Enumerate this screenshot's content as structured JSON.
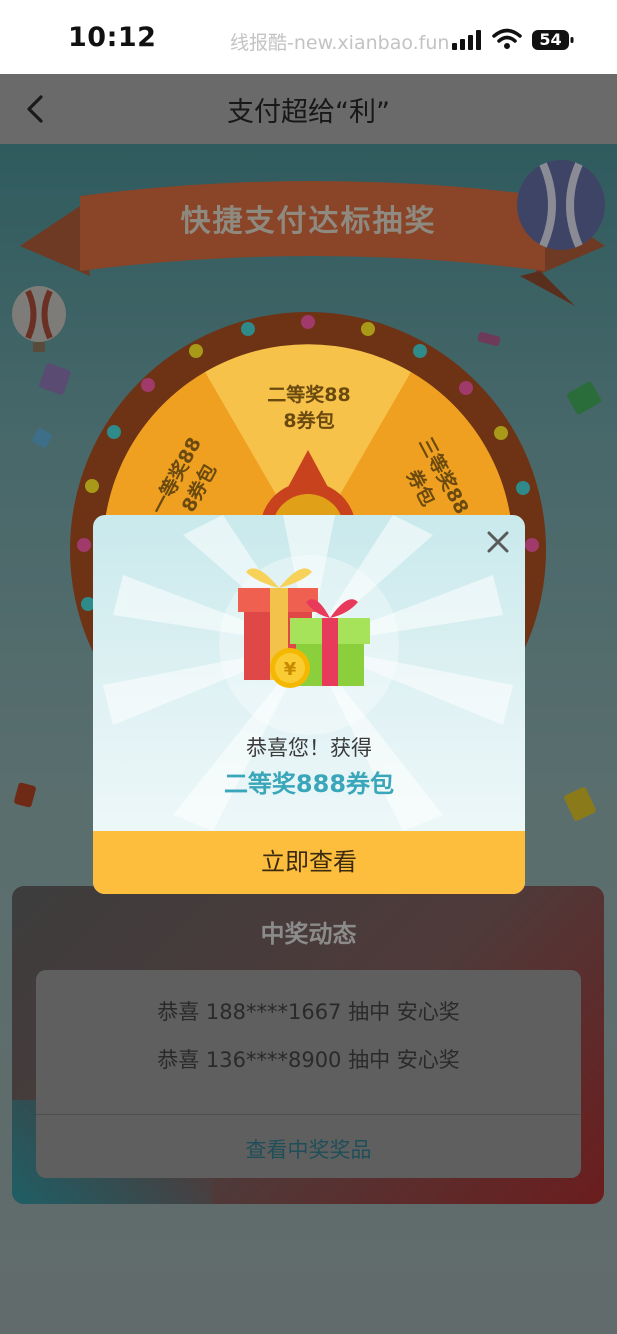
{
  "status_bar": {
    "time": "10:12",
    "watermark": "线报酷-new.xianbao.fun",
    "battery": "54"
  },
  "nav": {
    "title": "支付超给“利”"
  },
  "banner": {
    "title": "快捷支付达标抽奖"
  },
  "wheel": {
    "segments": [
      {
        "label": "二等奖88\n8券包"
      },
      {
        "label": "一等奖88\n8券包"
      },
      {
        "label": "三等奖88\n券包"
      }
    ]
  },
  "winners": {
    "title": "中奖动态",
    "items": [
      "恭喜 188****1667 抽中 安心奖",
      "恭喜 136****8900 抽中 安心奖"
    ],
    "view_link": "查看中奖奖品"
  },
  "modal": {
    "congrats": "恭喜您！获得",
    "prize": "二等奖888券包",
    "button": "立即查看"
  },
  "colors": {
    "accent_yellow": "#fdbd3d",
    "prize_teal": "#3aa6b9",
    "wheel_orange": "#f0a020"
  }
}
